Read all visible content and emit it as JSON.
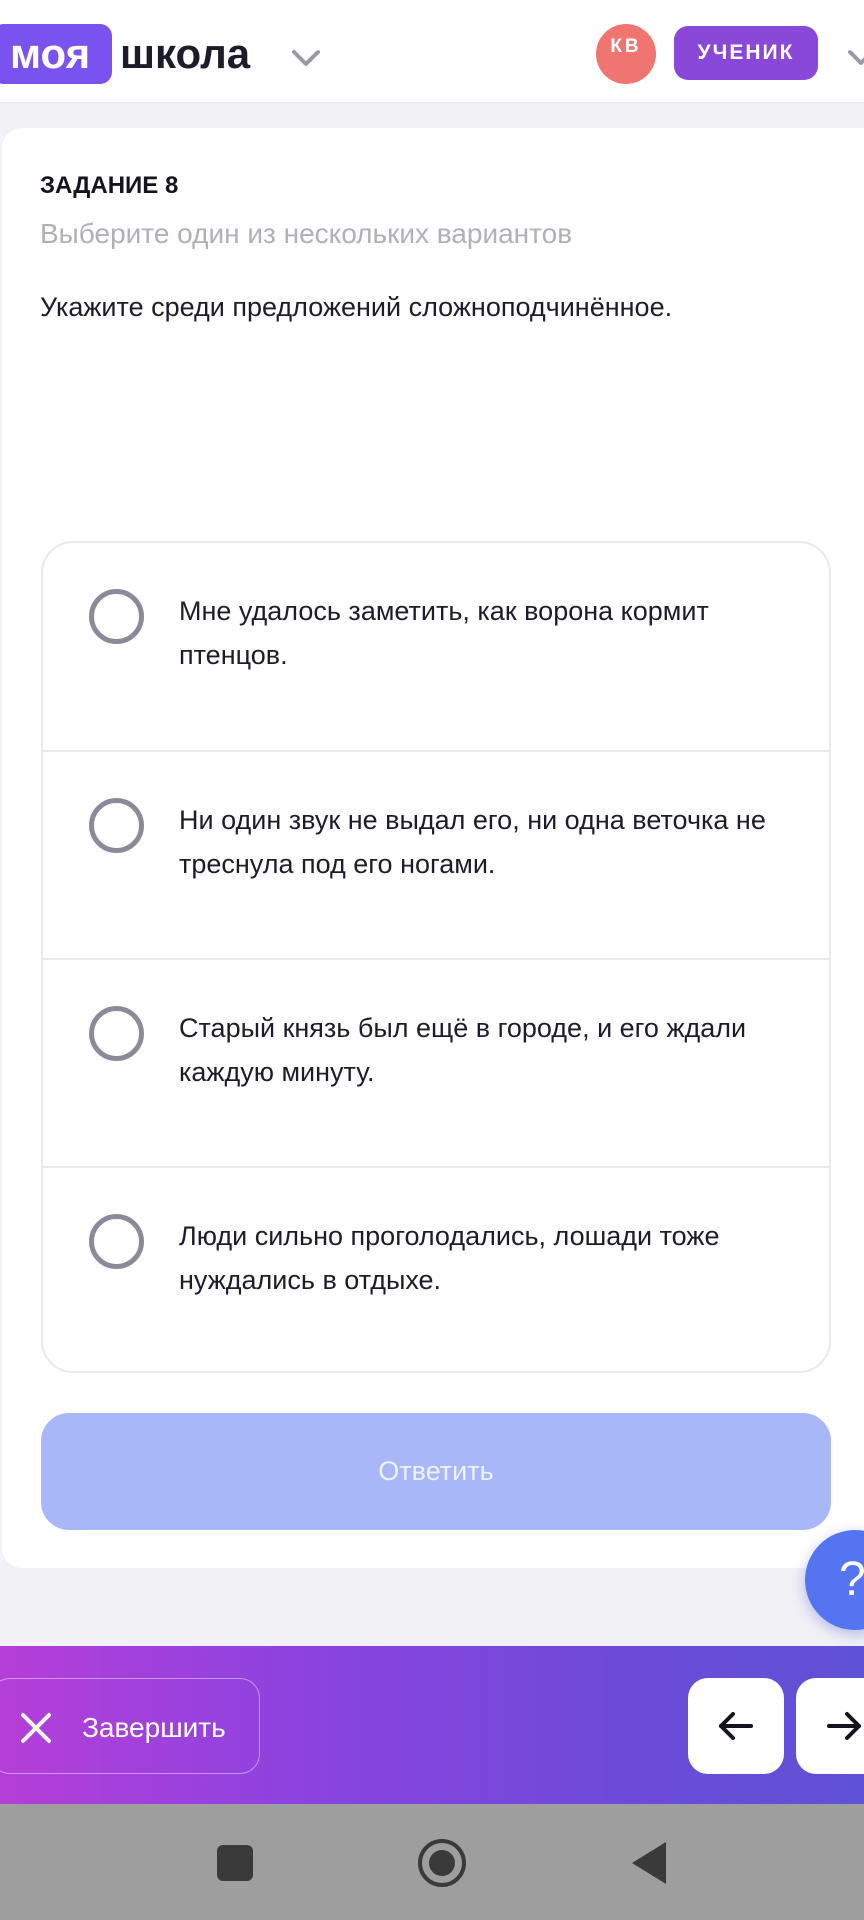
{
  "header": {
    "logo_part1": "моя",
    "logo_part2": "школа",
    "avatar_initials": "КВ",
    "role_badge": "УЧЕНИК"
  },
  "task": {
    "title": "ЗАДАНИЕ 8",
    "subtitle": "Выберите один из нескольких вариантов",
    "question": "Укажите среди предложений сложноподчинённое.",
    "options": [
      {
        "text": "Мне удалось заметить, как ворона кормит птенцов.",
        "selected": false
      },
      {
        "text": "Ни один звук не выдал его, ни одна веточка не треснула под его ногами.",
        "selected": false
      },
      {
        "text": "Старый князь был ещё в городе, и его ждали каждую минуту.",
        "selected": false
      },
      {
        "text": "Люди сильно проголодались, лошади тоже нуждались в отдыхе.",
        "selected": false
      }
    ],
    "answer_button": "Ответить"
  },
  "help_button": "?",
  "bottom_bar": {
    "finish_label": "Завершить"
  },
  "colors": {
    "logo_accent": "#7a52f0",
    "avatar": "#f07570",
    "role_badge": "#8a48d8",
    "answer_button_disabled": "#a7b7f7",
    "help_button": "#5474f2",
    "bottom_gradient_start": "#b53ed8",
    "bottom_gradient_end": "#5e52d6",
    "system_nav": "#9e9e9e"
  },
  "icons": {
    "logo_dropdown": "chevron-down-icon",
    "header_dropdown": "chevron-down-icon",
    "finish": "close-icon",
    "prev": "arrow-left-icon",
    "next": "arrow-right-icon",
    "system_recents": "square-icon",
    "system_home": "circle-icon",
    "system_back": "triangle-back-icon"
  }
}
